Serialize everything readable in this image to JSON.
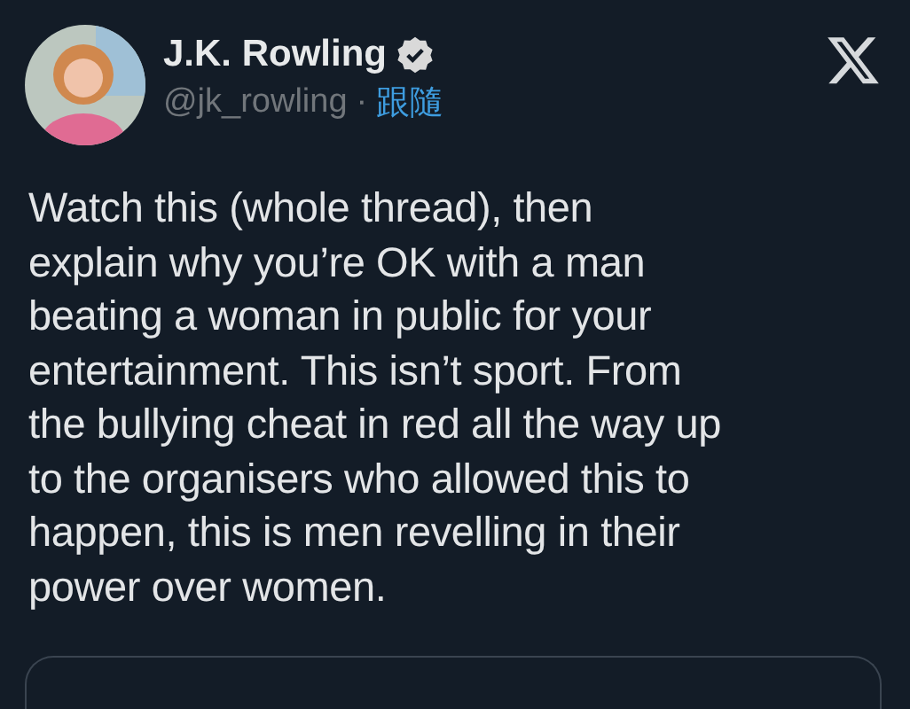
{
  "author": {
    "name": "J.K. Rowling",
    "verified": true,
    "handle": "@jk_rowling",
    "separator": "·",
    "follow": "跟隨"
  },
  "text_lines": [
    "Watch this (whole thread), then",
    "explain why you’re OK with a man",
    "beating a woman in public for your",
    "entertainment. This isn’t sport. From",
    "the bullying cheat in red all the way up",
    "to the organisers who allowed this to",
    "happen, this is men revelling in their",
    "power over women."
  ]
}
